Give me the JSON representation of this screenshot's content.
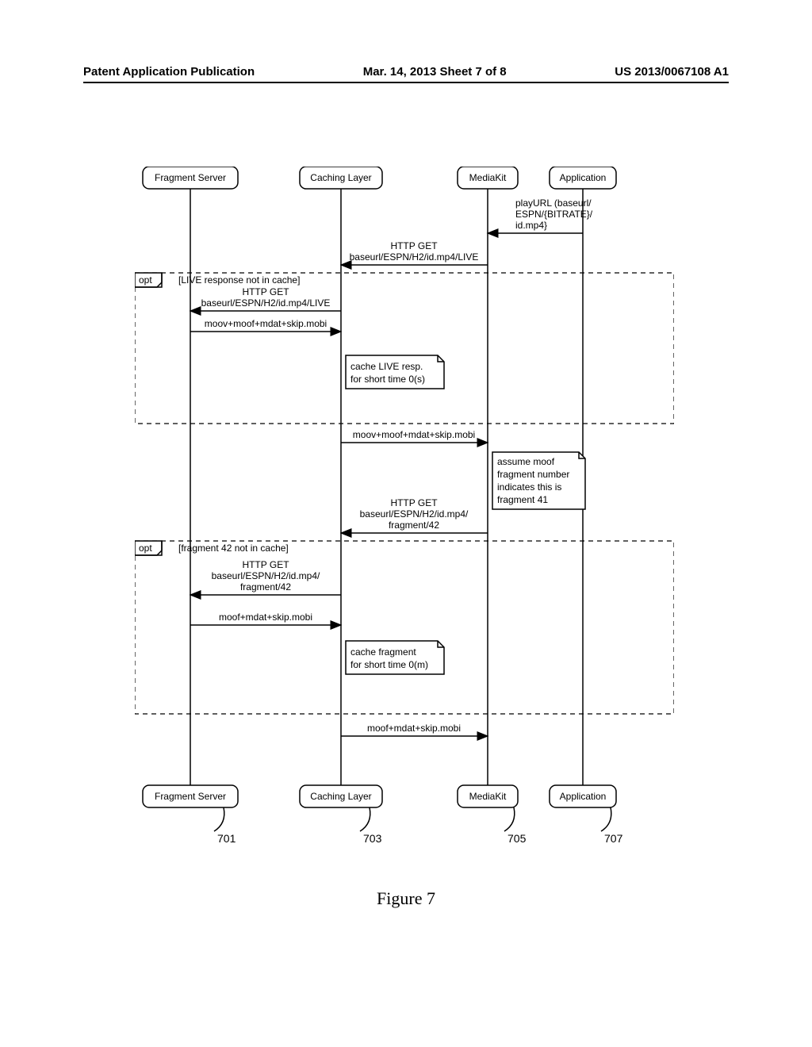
{
  "header": {
    "left": "Patent Application Publication",
    "center": "Mar. 14, 2013  Sheet 7 of 8",
    "right": "US 2013/0067108 A1"
  },
  "participants": {
    "p1": "Fragment Server",
    "p2": "Caching Layer",
    "p3": "MediaKit",
    "p4": "Application"
  },
  "refs": {
    "r1": "701",
    "r2": "703",
    "r3": "705",
    "r4": "707"
  },
  "messages": {
    "m_play1": "playURL (baseurl/",
    "m_play2": "ESPN/{BITRATE}/",
    "m_play3": "id.mp4}",
    "m_get_live_mk1": "HTTP GET",
    "m_get_live_mk2": "baseurl/ESPN/H2/id.mp4/LIVE",
    "opt1_label": "opt",
    "opt1_guard": "[LIVE response not in cache]",
    "m_get_live_fs1": "HTTP GET",
    "m_get_live_fs2": "baseurl/ESPN/H2/id.mp4/LIVE",
    "m_moov_fs": "moov+moof+mdat+skip.mobi",
    "note_cache_live1": "cache LIVE resp.",
    "note_cache_live2": "for short time 0(s)",
    "m_moov_mk": "moov+moof+mdat+skip.mobi",
    "note_moof1": "assume moof",
    "note_moof2": "fragment number",
    "note_moof3": "indicates this is",
    "note_moof4": "fragment 41",
    "m_get42_mk1": "HTTP GET",
    "m_get42_mk2": "baseurl/ESPN/H2/id.mp4/",
    "m_get42_mk3": "fragment/42",
    "opt2_label": "opt",
    "opt2_guard": "[fragment 42 not in cache]",
    "m_get42_fs1": "HTTP GET",
    "m_get42_fs2": "baseurl/ESPN/H2/id.mp4/",
    "m_get42_fs3": "fragment/42",
    "m_moof_fs": "moof+mdat+skip.mobi",
    "note_cache_frag1": "cache fragment",
    "note_cache_frag2": "for short time 0(m)",
    "m_moof_mk": "moof+mdat+skip.mobi"
  },
  "caption": "Figure 7"
}
